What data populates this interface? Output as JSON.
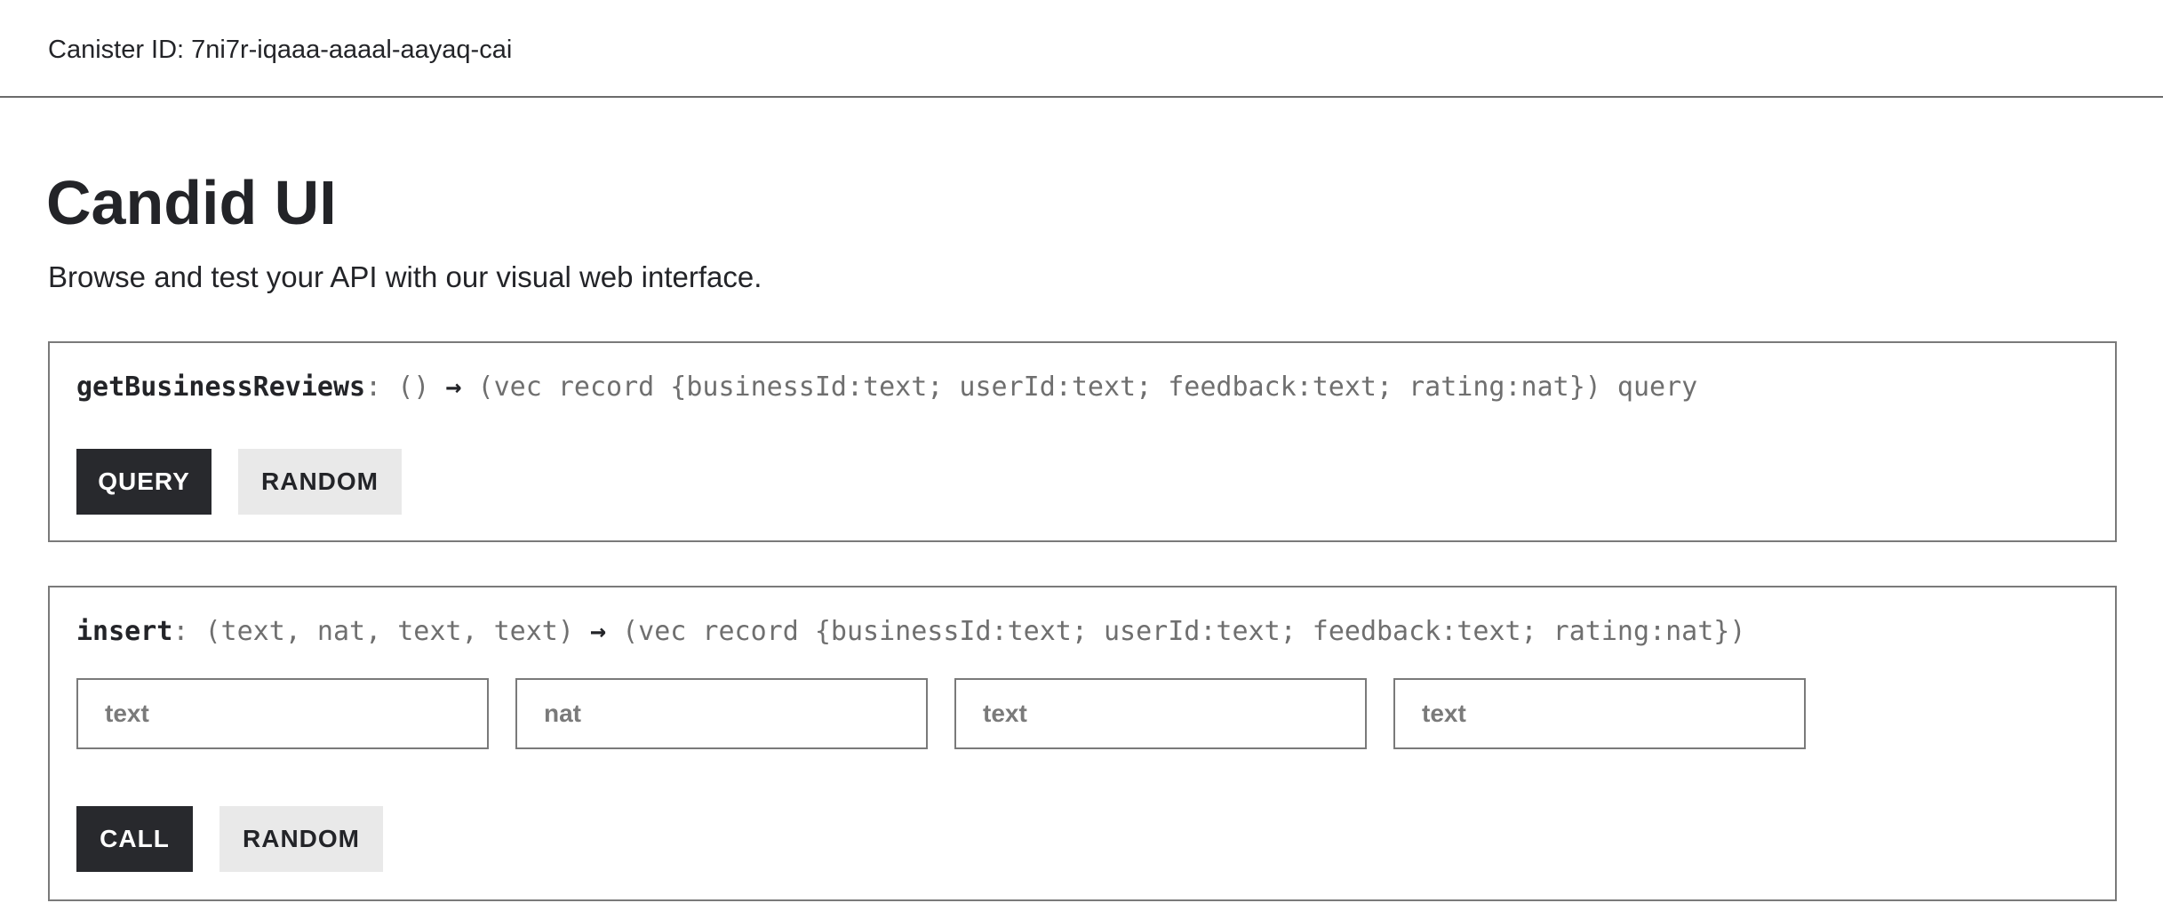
{
  "header": {
    "canister_label": "Canister ID: 7ni7r-iqaaa-aaaal-aayaq-cai"
  },
  "page": {
    "title": "Candid UI",
    "subtitle": "Browse and test your API with our visual web interface."
  },
  "methods": [
    {
      "name": "getBusinessReviews",
      "params": ": () ",
      "arrow": "→",
      "returns": " (vec record {businessId:text; userId:text; feedback:text; rating:nat}) query",
      "primary_label": "QUERY",
      "random_label": "RANDOM",
      "inputs": []
    },
    {
      "name": "insert",
      "params": ": (text, nat, text, text) ",
      "arrow": "→",
      "returns": " (vec record {businessId:text; userId:text; feedback:text; rating:nat})",
      "primary_label": "CALL",
      "random_label": "RANDOM",
      "inputs": [
        {
          "placeholder": "text",
          "value": ""
        },
        {
          "placeholder": "nat",
          "value": ""
        },
        {
          "placeholder": "text",
          "value": ""
        },
        {
          "placeholder": "text",
          "value": ""
        }
      ]
    }
  ],
  "colors": {
    "dark_button": "#28292d",
    "light_button": "#e9e9e9",
    "text": "#232428",
    "border": "#7a7a7a"
  }
}
